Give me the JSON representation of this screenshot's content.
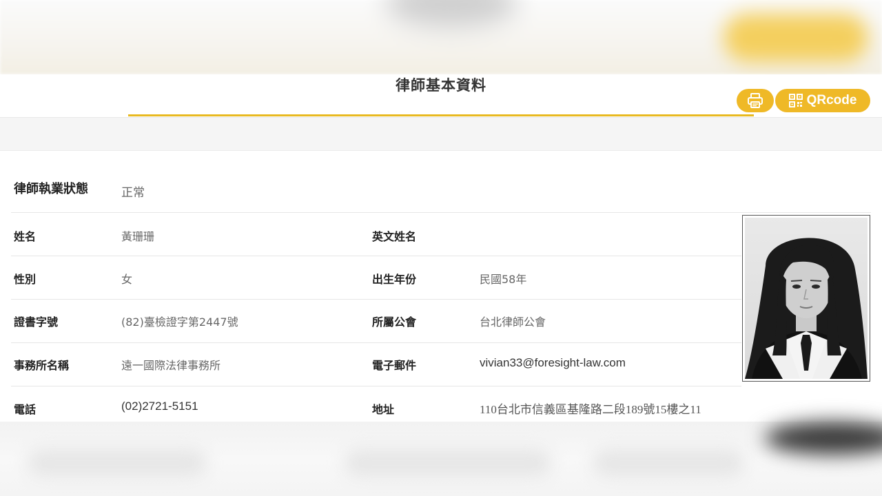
{
  "header": {
    "title": "律師基本資料",
    "print_icon": "printer-icon",
    "qr_icon": "qrcode-icon",
    "qr_label": "QRcode",
    "accent_color": "#efb927"
  },
  "profile": {
    "status_label": "律師執業狀態",
    "status_value": "正常",
    "name_label": "姓名",
    "name_value": "黃珊珊",
    "english_name_label": "英文姓名",
    "english_name_value": "",
    "gender_label": "性別",
    "gender_value": "女",
    "birth_year_label": "出生年份",
    "birth_year_value": "民國58年",
    "license_label": "證書字號",
    "license_value": "(82)臺檢證字第2447號",
    "bar_label": "所屬公會",
    "bar_value": "台北律師公會",
    "firm_label": "事務所名稱",
    "firm_value": "遠一國際法律事務所",
    "email_label": "電子郵件",
    "email_value": "vivian33@foresight-law.com",
    "phone_label": "電話",
    "phone_value": "(02)2721-5151",
    "address_label": "地址",
    "address_value": "110台北市信義區基隆路二段189號15樓之11"
  }
}
